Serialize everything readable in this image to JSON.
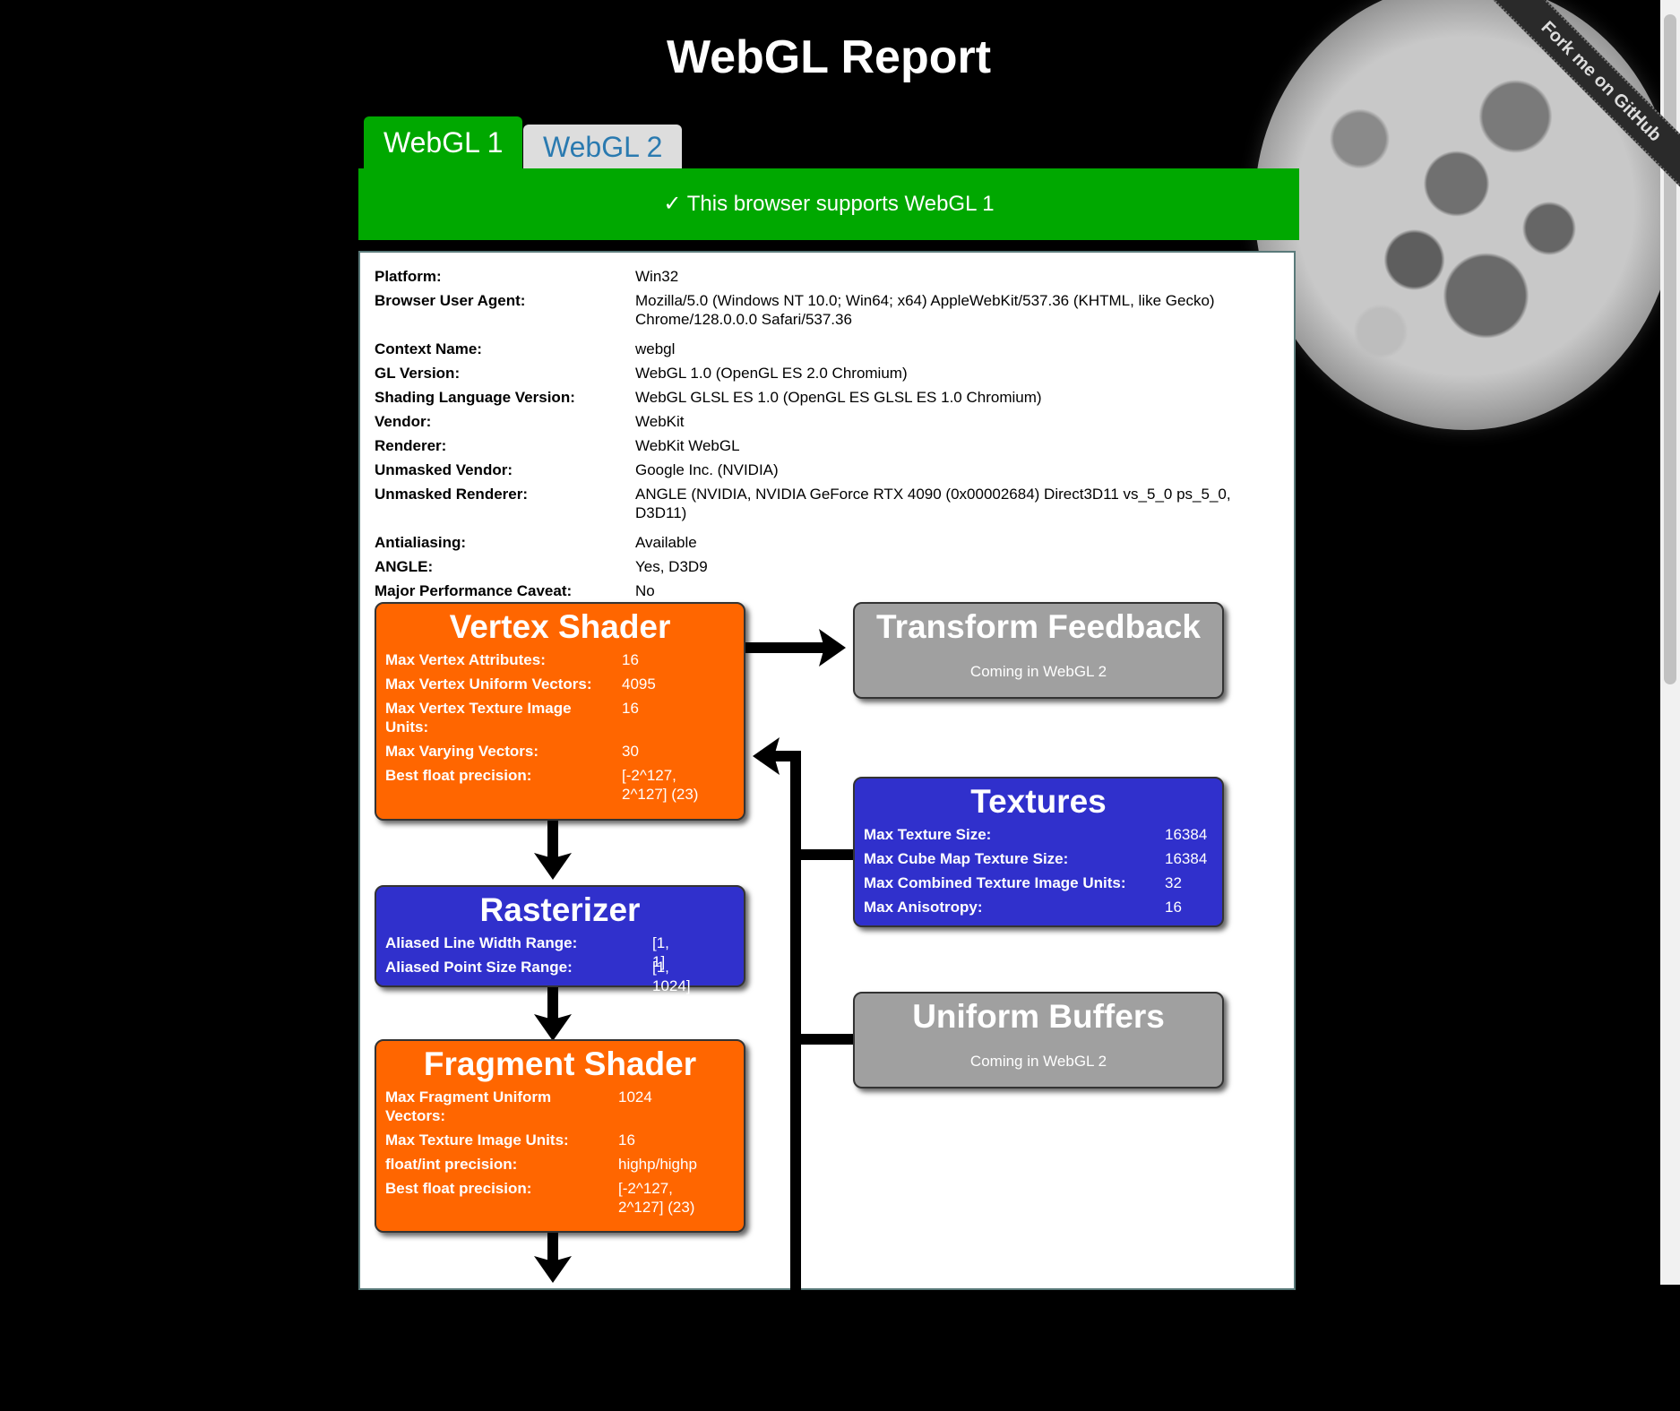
{
  "title": "WebGL Report",
  "fork_ribbon": "Fork me on GitHub",
  "tabs": [
    {
      "label": "WebGL 1",
      "active": true
    },
    {
      "label": "WebGL 2",
      "active": false
    }
  ],
  "support_message": "✓ This browser supports WebGL 1",
  "info": [
    {
      "label": "Platform:",
      "value": "Win32"
    },
    {
      "label": "Browser User Agent:",
      "value": "Mozilla/5.0 (Windows NT 10.0; Win64; x64) AppleWebKit/537.36 (KHTML, like Gecko) Chrome/128.0.0.0 Safari/537.36"
    },
    {
      "label": "Context Name:",
      "value": "webgl"
    },
    {
      "label": "GL Version:",
      "value": "WebGL 1.0 (OpenGL ES 2.0 Chromium)"
    },
    {
      "label": "Shading Language Version:",
      "value": "WebGL GLSL ES 1.0 (OpenGL ES GLSL ES 1.0 Chromium)"
    },
    {
      "label": "Vendor:",
      "value": "WebKit"
    },
    {
      "label": "Renderer:",
      "value": "WebKit WebGL"
    },
    {
      "label": "Unmasked Vendor:",
      "value": "Google Inc. (NVIDIA)"
    },
    {
      "label": "Unmasked Renderer:",
      "value": "ANGLE (NVIDIA, NVIDIA GeForce RTX 4090 (0x00002684) Direct3D11 vs_5_0 ps_5_0, D3D11)"
    },
    {
      "label": "Antialiasing:",
      "value": "Available"
    },
    {
      "label": "ANGLE:",
      "value": "Yes, D3D9"
    },
    {
      "label": "Major Performance Caveat:",
      "value": "No"
    }
  ],
  "vertex_shader": {
    "title": "Vertex Shader",
    "rows": [
      {
        "label": "Max Vertex Attributes:",
        "value": "16"
      },
      {
        "label": "Max Vertex Uniform Vectors:",
        "value": "4095"
      },
      {
        "label": "Max Vertex Texture Image Units:",
        "value": "16"
      },
      {
        "label": "Max Varying Vectors:",
        "value": "30"
      },
      {
        "label": "Best float precision:",
        "value": "[-2^127, 2^127] (23)"
      }
    ]
  },
  "transform_feedback": {
    "title": "Transform Feedback",
    "note": "Coming in WebGL 2"
  },
  "rasterizer": {
    "title": "Rasterizer",
    "rows": [
      {
        "label": "Aliased Line Width Range:",
        "value": "[1, 1]"
      },
      {
        "label": "Aliased Point Size Range:",
        "value": "[1, 1024]"
      }
    ]
  },
  "textures": {
    "title": "Textures",
    "rows": [
      {
        "label": "Max Texture Size:",
        "value": "16384"
      },
      {
        "label": "Max Cube Map Texture Size:",
        "value": "16384"
      },
      {
        "label": "Max Combined Texture Image Units:",
        "value": "32"
      },
      {
        "label": "Max Anisotropy:",
        "value": "16"
      }
    ]
  },
  "uniform_buffers": {
    "title": "Uniform Buffers",
    "note": "Coming in WebGL 2"
  },
  "fragment_shader": {
    "title": "Fragment Shader",
    "rows": [
      {
        "label": "Max Fragment Uniform Vectors:",
        "value": "1024"
      },
      {
        "label": "Max Texture Image Units:",
        "value": "16"
      },
      {
        "label": "float/int precision:",
        "value": "highp/highp"
      },
      {
        "label": "Best float precision:",
        "value": "[-2^127, 2^127] (23)"
      }
    ]
  }
}
